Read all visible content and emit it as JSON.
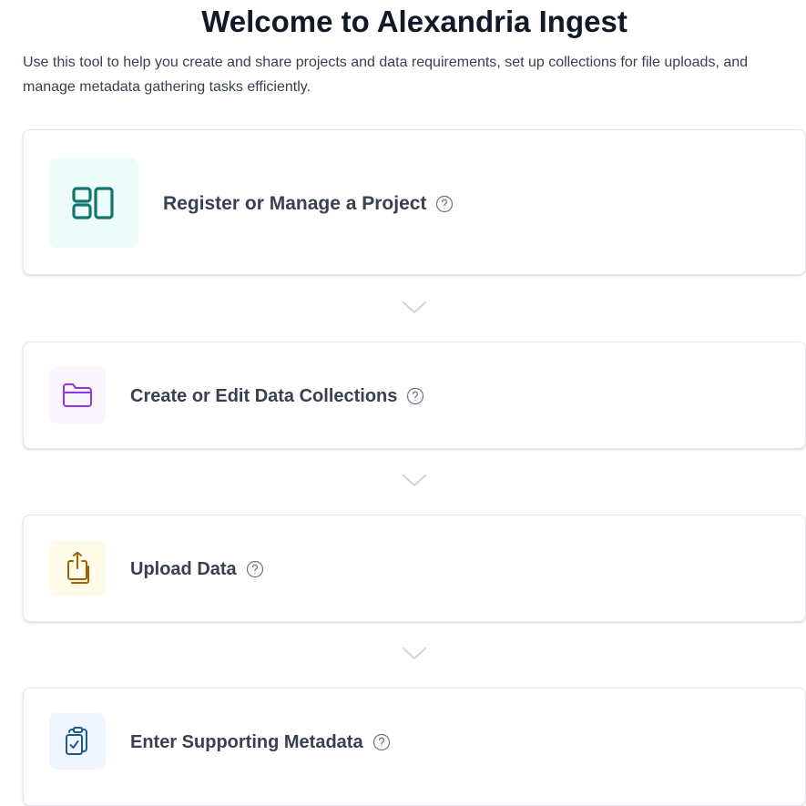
{
  "page": {
    "title": "Welcome to Alexandria Ingest",
    "intro": "Use this tool to help you create and share projects and data requirements, set up collections for file uploads, and manage metadata gathering tasks efficiently."
  },
  "steps": [
    {
      "label": "Register or Manage a Project",
      "icon": "project-layout-icon",
      "icon_bg": "#effdfa",
      "icon_color": "#0f766e"
    },
    {
      "label": "Create or Edit Data Collections",
      "icon": "folder-icon",
      "icon_bg": "#faf5ff",
      "icon_color": "#9333ea"
    },
    {
      "label": "Upload Data",
      "icon": "upload-icon",
      "icon_bg": "#fefce8",
      "icon_color": "#a16207"
    },
    {
      "label": "Enter Supporting Metadata",
      "icon": "clipboard-check-icon",
      "icon_bg": "#eff6ff",
      "icon_color": "#1e5a8a"
    }
  ],
  "connector_icon": "chevron-down-icon",
  "help_icon": "question-circle-icon"
}
